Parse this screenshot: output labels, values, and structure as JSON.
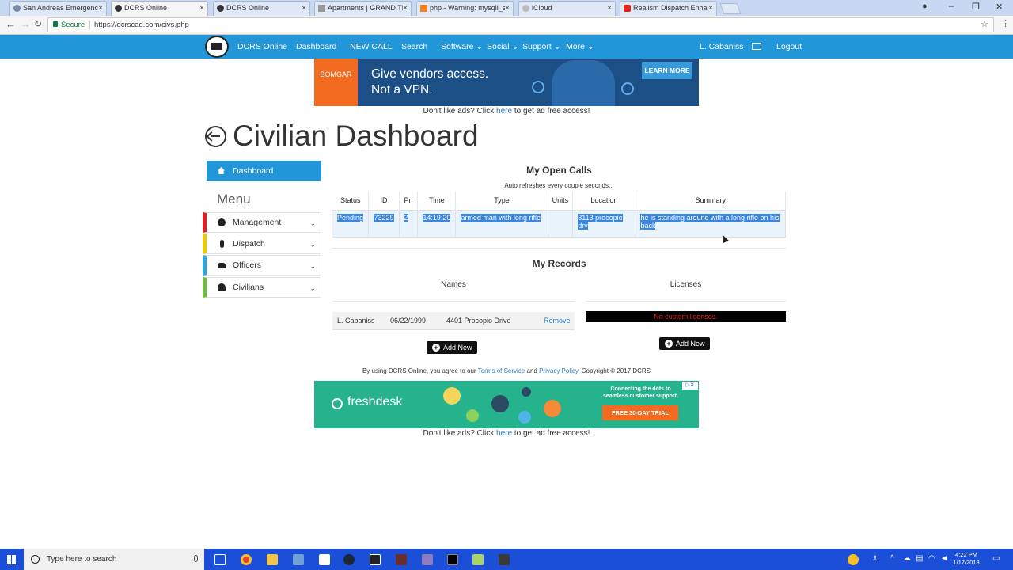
{
  "browser": {
    "tabs": [
      {
        "title": "San Andreas Emergency",
        "active": false
      },
      {
        "title": "DCRS Online",
        "active": true
      },
      {
        "title": "DCRS Online",
        "active": false
      },
      {
        "title": "Apartments | GRAND TH",
        "active": false
      },
      {
        "title": "php - Warning: mysqli_e",
        "active": false
      },
      {
        "title": "iCloud",
        "active": false
      },
      {
        "title": "Realism Dispatch Enhanc",
        "active": false
      }
    ],
    "secure_label": "Secure",
    "url": "https://dcrscad.com/civs.php"
  },
  "nav": {
    "brand": "DCRS Online",
    "items": [
      "Dashboard",
      "NEW CALL",
      "Search",
      "Software",
      "Social",
      "Support",
      "More"
    ],
    "user": "L. Cabaniss",
    "logout": "Logout"
  },
  "ad_top": {
    "brand": "BOMGAR",
    "headline_line1": "Give vendors access.",
    "headline_line2": "Not a VPN.",
    "cta": "LEARN MORE"
  },
  "ad_note": {
    "prefix": "Don't like ads? Click",
    "link": "here",
    "suffix": "to get ad free access!"
  },
  "page_title": "Civilian Dashboard",
  "sidebar": {
    "active_item": "Dashboard",
    "menu_heading": "Menu",
    "items": [
      {
        "label": "Management",
        "color": "#e02020"
      },
      {
        "label": "Dispatch",
        "color": "#f2c800"
      },
      {
        "label": "Officers",
        "color": "#2aa6e0"
      },
      {
        "label": "Civilians",
        "color": "#6cbf3a"
      }
    ]
  },
  "open_calls": {
    "title": "My Open Calls",
    "note": "Auto refreshes every couple seconds...",
    "columns": [
      "Status",
      "ID",
      "Pri",
      "Time",
      "Type",
      "Units",
      "Location",
      "Summary"
    ],
    "rows": [
      {
        "status": "Pending",
        "id": "73229",
        "pri": "2",
        "time": "14:19:20",
        "type": "armed man with long rifle",
        "units": "",
        "location": "3113 procopio drv",
        "summary": "he is standing around with a long rifle on his back"
      }
    ]
  },
  "records": {
    "title": "My Records",
    "names_heading": "Names",
    "licenses_heading": "Licenses",
    "names": [
      {
        "name": "L. Cabaniss",
        "dob": "06/22/1999",
        "address": "4401 Procopio Drive",
        "action": "Remove"
      }
    ],
    "no_licenses": "No custom licenses.",
    "add_new": "Add New"
  },
  "footer": {
    "prefix": "By using DCRS Online, you agree to our",
    "terms": "Terms of Service",
    "and": "and",
    "privacy": "Privacy Policy",
    "suffix": ". Copyright © 2017 DCRS"
  },
  "ad_bottom": {
    "brand": "freshdesk",
    "tagline": "Connecting the dots to seamless customer support.",
    "cta": "FREE 30-DAY TRIAL"
  },
  "taskbar": {
    "search_placeholder": "Type here to search",
    "time": "4:22 PM",
    "date": "1/17/2018"
  },
  "colors": {
    "primary": "#2196d9",
    "selection": "#3b86e0",
    "taskbar": "#1b4fd8"
  }
}
